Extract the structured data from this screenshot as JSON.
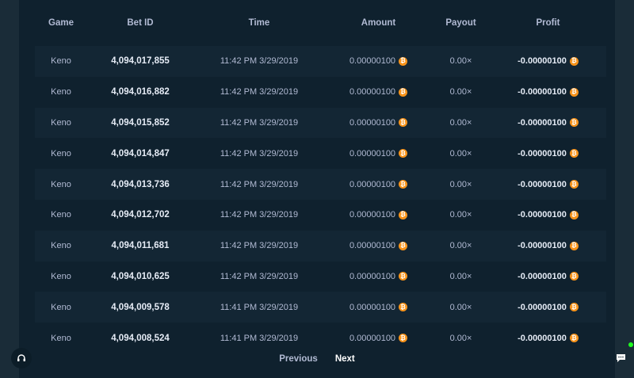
{
  "table": {
    "headers": {
      "game": "Game",
      "bet_id": "Bet ID",
      "time": "Time",
      "amount": "Amount",
      "payout": "Payout",
      "profit": "Profit"
    },
    "currency_icon": "bitcoin-icon",
    "rows": [
      {
        "game": "Keno",
        "bet_id": "4,094,017,855",
        "time": "11:42 PM 3/29/2019",
        "amount": "0.00000100",
        "payout": "0.00×",
        "profit": "-0.00000100"
      },
      {
        "game": "Keno",
        "bet_id": "4,094,016,882",
        "time": "11:42 PM 3/29/2019",
        "amount": "0.00000100",
        "payout": "0.00×",
        "profit": "-0.00000100"
      },
      {
        "game": "Keno",
        "bet_id": "4,094,015,852",
        "time": "11:42 PM 3/29/2019",
        "amount": "0.00000100",
        "payout": "0.00×",
        "profit": "-0.00000100"
      },
      {
        "game": "Keno",
        "bet_id": "4,094,014,847",
        "time": "11:42 PM 3/29/2019",
        "amount": "0.00000100",
        "payout": "0.00×",
        "profit": "-0.00000100"
      },
      {
        "game": "Keno",
        "bet_id": "4,094,013,736",
        "time": "11:42 PM 3/29/2019",
        "amount": "0.00000100",
        "payout": "0.00×",
        "profit": "-0.00000100"
      },
      {
        "game": "Keno",
        "bet_id": "4,094,012,702",
        "time": "11:42 PM 3/29/2019",
        "amount": "0.00000100",
        "payout": "0.00×",
        "profit": "-0.00000100"
      },
      {
        "game": "Keno",
        "bet_id": "4,094,011,681",
        "time": "11:42 PM 3/29/2019",
        "amount": "0.00000100",
        "payout": "0.00×",
        "profit": "-0.00000100"
      },
      {
        "game": "Keno",
        "bet_id": "4,094,010,625",
        "time": "11:42 PM 3/29/2019",
        "amount": "0.00000100",
        "payout": "0.00×",
        "profit": "-0.00000100"
      },
      {
        "game": "Keno",
        "bet_id": "4,094,009,578",
        "time": "11:41 PM 3/29/2019",
        "amount": "0.00000100",
        "payout": "0.00×",
        "profit": "-0.00000100"
      },
      {
        "game": "Keno",
        "bet_id": "4,094,008,524",
        "time": "11:41 PM 3/29/2019",
        "amount": "0.00000100",
        "payout": "0.00×",
        "profit": "-0.00000100"
      }
    ]
  },
  "pagination": {
    "previous": "Previous",
    "next": "Next"
  },
  "colors": {
    "background": "#1a2c38",
    "panel": "#0f212e",
    "coin": "#f7931a",
    "online": "#1fff20"
  },
  "widgets": {
    "support_icon": "headset-icon",
    "chat_icon": "chat-bubble-icon"
  }
}
